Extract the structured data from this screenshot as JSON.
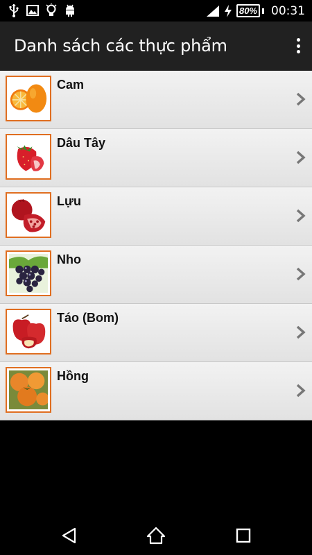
{
  "status_bar": {
    "icons": [
      "usb-icon",
      "image-icon",
      "lightbulb-icon",
      "android-icon"
    ],
    "battery": "80%",
    "time": "00:31"
  },
  "action_bar": {
    "title": "Danh sách các thực phẩm",
    "menu_icon": "overflow-menu-icon"
  },
  "list": {
    "items": [
      {
        "label": "Cam",
        "image": "orange-image"
      },
      {
        "label": "Dâu Tây",
        "image": "strawberry-image"
      },
      {
        "label": "Lựu",
        "image": "pomegranate-image"
      },
      {
        "label": "Nho",
        "image": "grapes-image"
      },
      {
        "label": "Táo (Bom)",
        "image": "apple-image"
      },
      {
        "label": "Hồng",
        "image": "persimmon-image"
      }
    ]
  },
  "nav_bar": {
    "buttons": [
      "back-icon",
      "home-icon",
      "recent-apps-icon"
    ]
  },
  "colors": {
    "action_bar": "#212121",
    "thumb_border": "#e06e20",
    "row_bg": "#eaeaea"
  }
}
